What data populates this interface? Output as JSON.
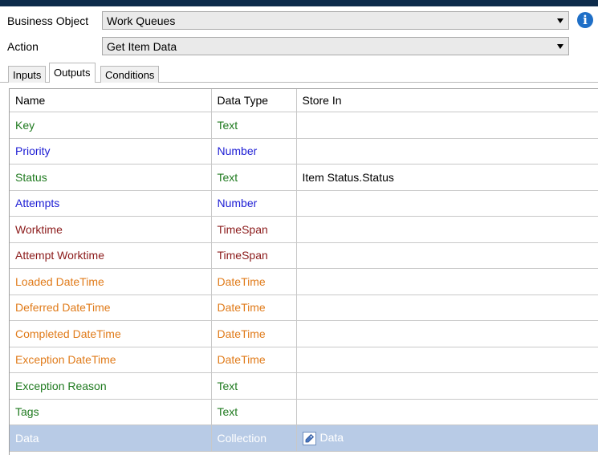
{
  "business_object": {
    "label": "Business Object",
    "value": "Work Queues"
  },
  "action": {
    "label": "Action",
    "value": "Get Item Data"
  },
  "tabs": [
    {
      "label": "Inputs",
      "active": false
    },
    {
      "label": "Outputs",
      "active": true
    },
    {
      "label": "Conditions",
      "active": false
    }
  ],
  "grid": {
    "headers": {
      "name": "Name",
      "data_type": "Data Type",
      "store_in": "Store In"
    },
    "rows": [
      {
        "name": "Key",
        "data_type": "Text",
        "store_in": ""
      },
      {
        "name": "Priority",
        "data_type": "Number",
        "store_in": ""
      },
      {
        "name": "Status",
        "data_type": "Text",
        "store_in": "Item Status.Status"
      },
      {
        "name": "Attempts",
        "data_type": "Number",
        "store_in": ""
      },
      {
        "name": "Worktime",
        "data_type": "TimeSpan",
        "store_in": ""
      },
      {
        "name": "Attempt Worktime",
        "data_type": "TimeSpan",
        "store_in": ""
      },
      {
        "name": "Loaded DateTime",
        "data_type": "DateTime",
        "store_in": ""
      },
      {
        "name": "Deferred DateTime",
        "data_type": "DateTime",
        "store_in": ""
      },
      {
        "name": "Completed DateTime",
        "data_type": "DateTime",
        "store_in": ""
      },
      {
        "name": "Exception DateTime",
        "data_type": "DateTime",
        "store_in": ""
      },
      {
        "name": "Exception Reason",
        "data_type": "Text",
        "store_in": ""
      },
      {
        "name": "Tags",
        "data_type": "Text",
        "store_in": ""
      },
      {
        "name": "Data",
        "data_type": "Collection",
        "store_in": "Data"
      }
    ]
  },
  "colors": {
    "text_type": "#1f7a1f",
    "number_type": "#1c1cd4",
    "timespan_type": "#8b1a1a",
    "datetime_type": "#e07b1a",
    "selected_row": "#b8cbe6",
    "info_icon": "#1f6fc7"
  },
  "icons": {
    "info": "info-icon",
    "dropdown": "chevron-down-icon",
    "data_item": "data-item-icon"
  }
}
